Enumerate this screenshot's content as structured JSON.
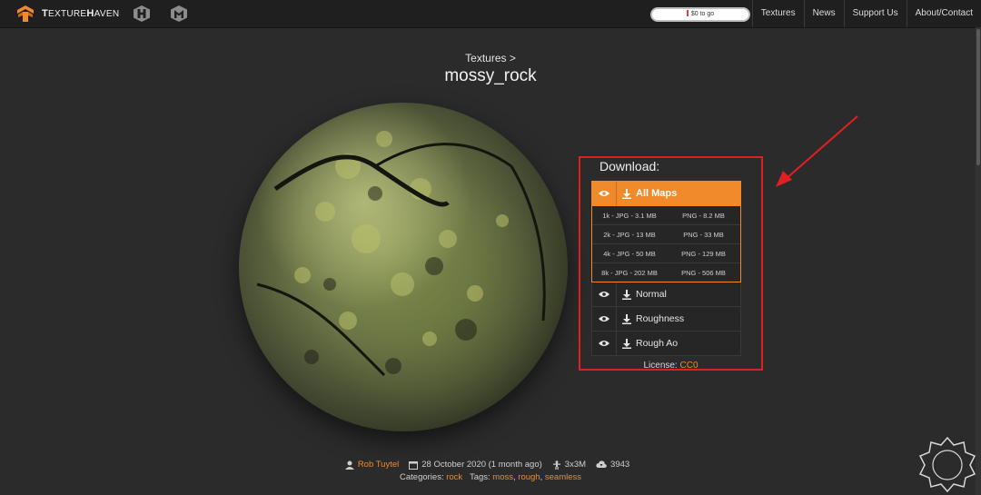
{
  "nav": {
    "logo_text_main": "T",
    "logo_text_rest": "EXTURE",
    "logo_text_main2": "H",
    "logo_text_rest2": "AVEN",
    "progress_label": "$0 to go",
    "links": [
      "Textures",
      "News",
      "Support Us",
      "About/Contact"
    ]
  },
  "heading": {
    "breadcrumb": "Textures >",
    "title": "mossy_rock"
  },
  "download": {
    "title": "Download:",
    "all_maps_label": "All Maps",
    "resolutions": [
      {
        "jpg": "1k - JPG - 3.1 MB",
        "png": "PNG - 8.2 MB"
      },
      {
        "jpg": "2k - JPG - 13 MB",
        "png": "PNG - 33 MB"
      },
      {
        "jpg": "4k - JPG - 50 MB",
        "png": "PNG - 129 MB"
      },
      {
        "jpg": "8k - JPG - 202 MB",
        "png": "PNG - 506 MB"
      }
    ],
    "maps": [
      "Normal",
      "Roughness",
      "Rough Ao"
    ],
    "license_label": "License:",
    "license_value": "CC0"
  },
  "info": {
    "author": "Rob Tuytel",
    "date": "28 October 2020 (1 month ago)",
    "scale": "3x3M",
    "downloads": "3943",
    "categories_label": "Categories:",
    "category": "rock",
    "tags_label": "Tags:",
    "tags": [
      "moss",
      "rough",
      "seamless"
    ]
  },
  "colors": {
    "accent": "#f08a2a",
    "annotation": "#e02020",
    "background": "#2b2b2b",
    "topbar": "#1f1f1f"
  },
  "icons": [
    "texturehaven-logo-icon",
    "hdrihaven-icon",
    "3dmodelhaven-icon",
    "eye-icon",
    "download-icon",
    "user-icon",
    "calendar-icon",
    "scale-icon",
    "cloud-download-icon"
  ]
}
